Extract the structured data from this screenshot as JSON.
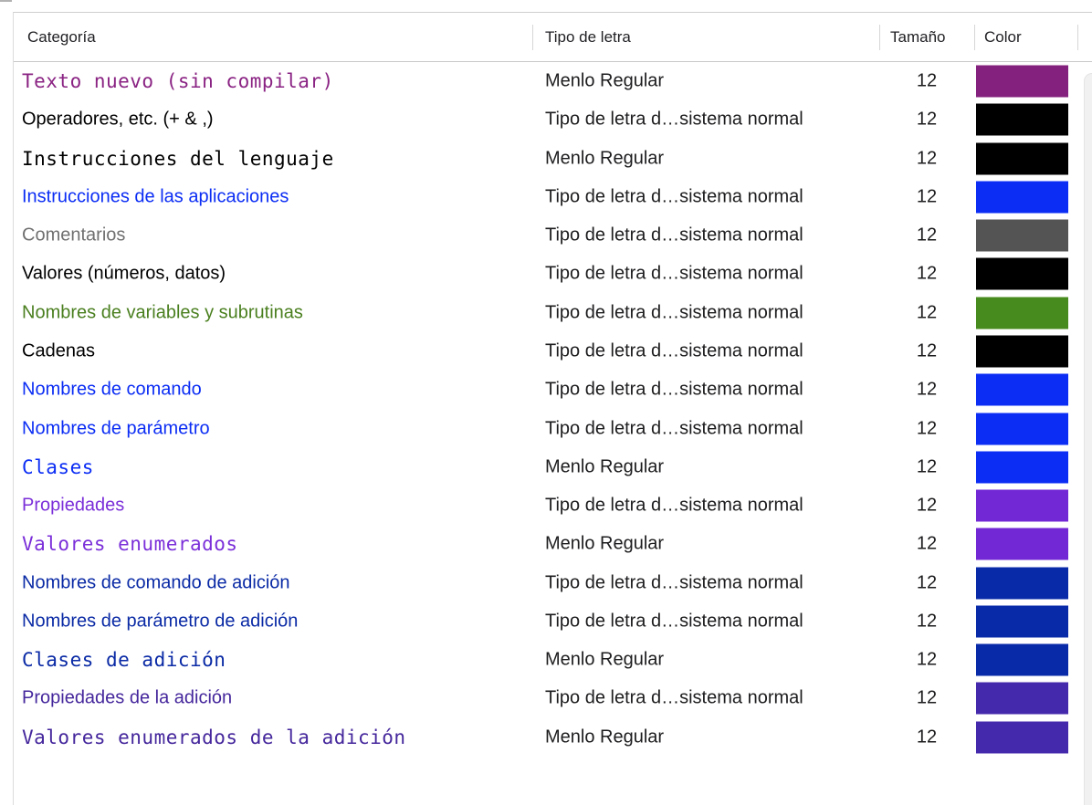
{
  "header": {
    "columns": [
      {
        "label": "Categoría"
      },
      {
        "label": "Tipo de letra"
      },
      {
        "label": "Tamaño"
      },
      {
        "label": "Color"
      }
    ]
  },
  "table": {
    "rows": [
      {
        "category": "Texto nuevo (sin compilar)",
        "tipo": "Menlo Regular",
        "size": "12",
        "color": "#8A2383",
        "swatch": "#84217E"
      },
      {
        "category": "Operadores, etc. (+ & ,)",
        "tipo": "Tipo de letra d…sistema normal",
        "size": "12",
        "color": "#000000",
        "swatch": "#000000"
      },
      {
        "category": "Instrucciones del lenguaje",
        "tipo": "Menlo Regular",
        "size": "12",
        "color": "#000000",
        "swatch": "#000000"
      },
      {
        "category": "Instrucciones de las aplicaciones",
        "tipo": "Tipo de letra d…sistema normal",
        "size": "12",
        "color": "#0B2DF4",
        "swatch": "#0B2DF4"
      },
      {
        "category": "Comentarios",
        "tipo": "Tipo de letra d…sistema normal",
        "size": "12",
        "color": "#707070",
        "swatch": "#545454"
      },
      {
        "category": "Valores (números, datos)",
        "tipo": "Tipo de letra d…sistema normal",
        "size": "12",
        "color": "#000000",
        "swatch": "#000000"
      },
      {
        "category": "Nombres de variables y subrutinas",
        "tipo": "Tipo de letra d…sistema normal",
        "size": "12",
        "color": "#4A7F1F",
        "swatch": "#478A1D"
      },
      {
        "category": "Cadenas",
        "tipo": "Tipo de letra d…sistema normal",
        "size": "12",
        "color": "#000000",
        "swatch": "#000000"
      },
      {
        "category": "Nombres de comando",
        "tipo": "Tipo de letra d…sistema normal",
        "size": "12",
        "color": "#0B2DF4",
        "swatch": "#0B2DF4"
      },
      {
        "category": "Nombres de parámetro",
        "tipo": "Tipo de letra d…sistema normal",
        "size": "12",
        "color": "#0B2DF4",
        "swatch": "#0B2DF4"
      },
      {
        "category": "Clases",
        "tipo": "Menlo Regular",
        "size": "12",
        "color": "#0B2DF4",
        "swatch": "#0B2DF4"
      },
      {
        "category": "Propiedades",
        "tipo": "Tipo de letra d…sistema normal",
        "size": "12",
        "color": "#7B2FD9",
        "swatch": "#7228D4"
      },
      {
        "category": "Valores enumerados",
        "tipo": "Menlo Regular",
        "size": "12",
        "color": "#7B2FD9",
        "swatch": "#7228D4"
      },
      {
        "category": "Nombres de comando de adición",
        "tipo": "Tipo de letra d…sistema normal",
        "size": "12",
        "color": "#0A2AA5",
        "swatch": "#082AA8"
      },
      {
        "category": "Nombres de parámetro de adición",
        "tipo": "Tipo de letra d…sistema normal",
        "size": "12",
        "color": "#0A2AA5",
        "swatch": "#082AA8"
      },
      {
        "category": "Clases de adición",
        "tipo": "Menlo Regular",
        "size": "12",
        "color": "#0A2AA5",
        "swatch": "#082AA8"
      },
      {
        "category": "Propiedades de la adición",
        "tipo": "Tipo de letra d…sistema normal",
        "size": "12",
        "color": "#45279C",
        "swatch": "#4529AC"
      },
      {
        "category": "Valores enumerados de la adición",
        "tipo": "Menlo Regular",
        "size": "12",
        "color": "#45279C",
        "swatch": "#4529AC"
      }
    ]
  }
}
